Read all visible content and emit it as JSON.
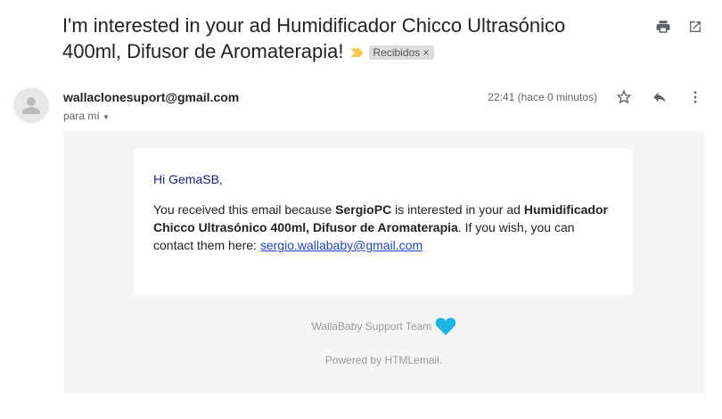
{
  "subject": "I'm interested in your ad Humidificador Chicco Ultrasónico 400ml, Difusor de Aromaterapia!",
  "label": "Recibidos",
  "label_remove": "×",
  "sender": "wallaclonesuport@gmail.com",
  "recipient": "para mí",
  "time": "22:41 (hace 0 minutos)",
  "icons": {
    "print": "print-icon",
    "open": "open-in-new-icon",
    "star": "star-icon",
    "reply": "reply-icon",
    "more": "more-vert-icon",
    "important": "important-marker-icon",
    "heart": "heart-icon"
  },
  "body": {
    "greeting": "Hi GemaSB,",
    "p1": "You received this email because ",
    "buyer": "SergioPC",
    "p2": " is interested in your ad ",
    "ad": "Humidificador Chicco Ultrasónico 400ml, Difusor de Aromaterapia",
    "p3": ". If you wish, you can contact them here: ",
    "email": "sergio.wallababy@gmail.com"
  },
  "footer": {
    "team": "WallaBaby Support Team",
    "powered": "Powered by HTMLemail."
  },
  "colors": {
    "heart": "#1cb4e3",
    "greeting": "#1a237e",
    "link": "#2046c9",
    "important": "#f5c84c"
  }
}
